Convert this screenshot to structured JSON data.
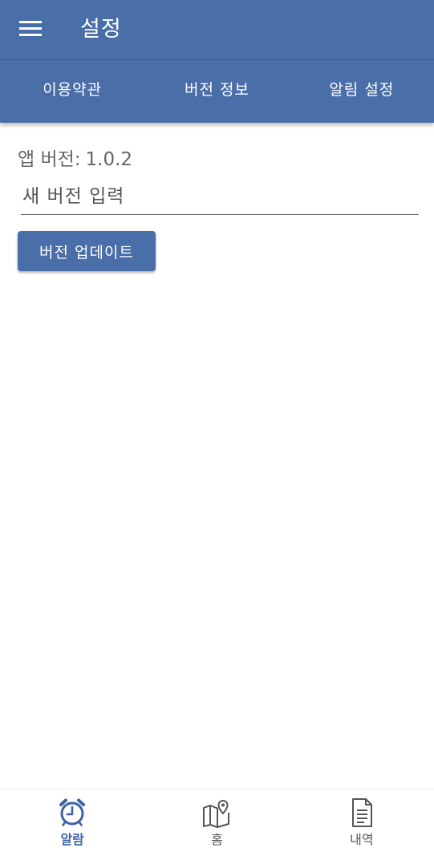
{
  "appbar": {
    "title": "설정",
    "menu_icon": "hamburger-menu-icon"
  },
  "tabs": [
    {
      "label": "이용약관"
    },
    {
      "label": "버전 정보"
    },
    {
      "label": "알림 설정"
    }
  ],
  "version": {
    "label": "앱 버전",
    "colon": ":",
    "value": "1.0.2"
  },
  "new_version_input": {
    "placeholder": "새 버전 입력",
    "value": ""
  },
  "update_button": {
    "label": "버전 업데이트"
  },
  "bottom_nav": {
    "items": [
      {
        "label": "알람",
        "icon": "alarm-clock-icon",
        "active": true
      },
      {
        "label": "홈",
        "icon": "map-pin-icon",
        "active": false
      },
      {
        "label": "내역",
        "icon": "document-icon",
        "active": false
      }
    ]
  },
  "colors": {
    "primary": "#4a6ea8",
    "active_nav": "#3f63a5",
    "inactive_nav": "#555555",
    "text_gray": "#666666"
  }
}
